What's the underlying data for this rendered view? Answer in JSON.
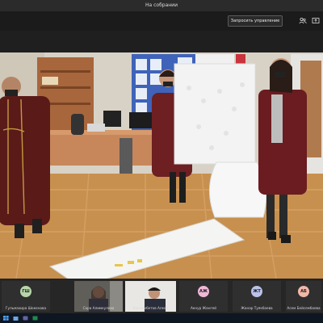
{
  "window": {
    "title": "На собрании"
  },
  "toolbar": {
    "request_control_label": "Запросить управление",
    "icons": [
      "people-icon",
      "share-icon"
    ]
  },
  "participants": [
    {
      "initials": "ГШ",
      "name": "Гульмахира Шокенова",
      "color": "#b7d7a8"
    },
    {
      "name": "Сара Алимкулова",
      "camera": true
    },
    {
      "name": "Лагмамбетов Алмат",
      "camera": true
    },
    {
      "initials": "АЖ",
      "name": "Акнур Жангей",
      "color": "#f0b7d9"
    },
    {
      "initials": "ЖТ",
      "name": "Жанар Туякбаева",
      "color": "#b9c3ea"
    },
    {
      "initials": "АБ",
      "name": "Асем Бейсембаева",
      "color": "#f2b8a8"
    }
  ],
  "taskbar": {
    "icons": [
      "windows-icon",
      "store-icon",
      "teams-icon",
      "excel-icon"
    ]
  }
}
